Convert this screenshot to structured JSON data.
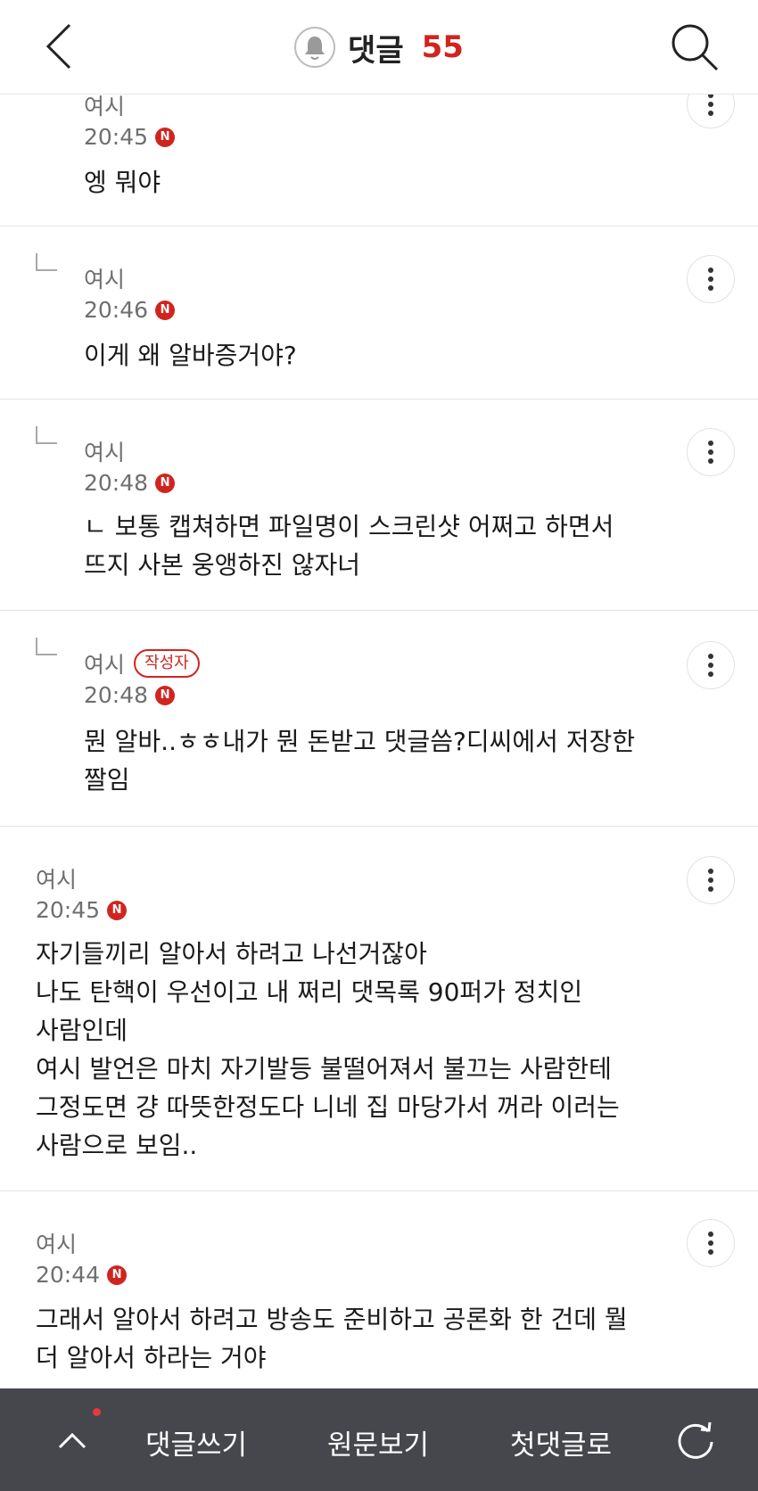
{
  "header": {
    "title": "댓글",
    "count": "55"
  },
  "comments": [
    {
      "author": "여시",
      "time": "20:45",
      "new_badge": "N",
      "text": "엥 뭐야"
    },
    {
      "author": "여시",
      "time": "20:46",
      "new_badge": "N",
      "text": "이게 왜 알바증거야?"
    },
    {
      "author": "여시",
      "time": "20:48",
      "new_badge": "N",
      "text": "ㄴ 보통 캡쳐하면 파일명이 스크린샷 어쩌고 하면서\n뜨지 사본 웅앵하진 않자너"
    },
    {
      "author": "여시",
      "writer_badge": "작성자",
      "time": "20:48",
      "new_badge": "N",
      "text": "뭔 알바..ㅎㅎ내가 뭔 돈받고 댓글씀?디씨에서 저장한\n짤임"
    },
    {
      "author": "여시",
      "time": "20:45",
      "new_badge": "N",
      "text": "자기들끼리 알아서 하려고 나선거잖아\n나도 탄핵이 우선이고 내 쩌리 댓목록 90퍼가 정치인\n사람인데\n여시 발언은 마치 자기발등 불떨어져서 불끄는 사람한테\n그정도면 걍 따뜻한정도다 니네 집 마당가서 꺼라 이러는\n사람으로 보임.."
    },
    {
      "author": "여시",
      "time": "20:44",
      "new_badge": "N",
      "text": "그래서 알아서 하려고 방송도 준비하고 공론화 한 건데 뭘\n더 알아서 하라는 거야"
    }
  ],
  "bottom_bar": {
    "write_comment": "댓글쓰기",
    "view_original": "원문보기",
    "first_comment": "첫댓글로"
  },
  "colors": {
    "accent": "#d0251f",
    "bar_bg": "#45474c"
  }
}
